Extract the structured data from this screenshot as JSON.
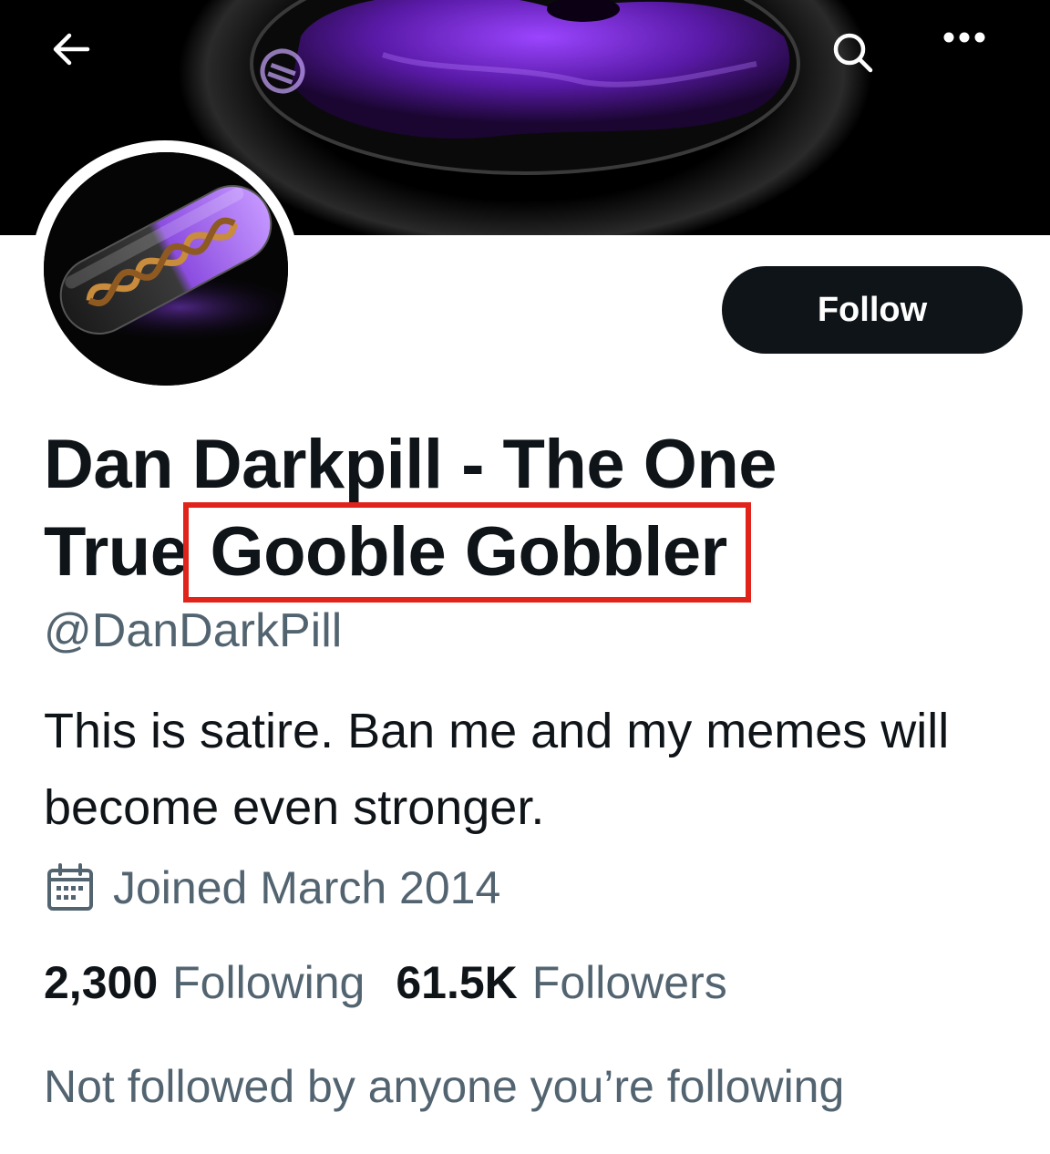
{
  "profile": {
    "display_name_part1": "Dan Darkpill - The One",
    "display_name_part2": "True",
    "display_name_highlight": "Gooble Gobbler",
    "handle": "@DanDarkPill",
    "bio": "This is satire. Ban me and my memes will become even stronger.",
    "joined": "Joined March 2014",
    "following_count": "2,300",
    "following_label": "Following",
    "followers_count": "61.5K",
    "followers_label": "Followers",
    "mutual_text": "Not followed by anyone you’re following"
  },
  "actions": {
    "follow_label": "Follow"
  },
  "icons": {
    "back": "back-arrow-icon",
    "search": "search-icon",
    "more": "more-icon",
    "calendar": "calendar-icon"
  },
  "colors": {
    "text_primary": "#0f1419",
    "text_secondary": "#536471",
    "button_bg": "#0f1419",
    "highlight_box": "#e0231b",
    "banner_accent": "#7a2fd0"
  }
}
